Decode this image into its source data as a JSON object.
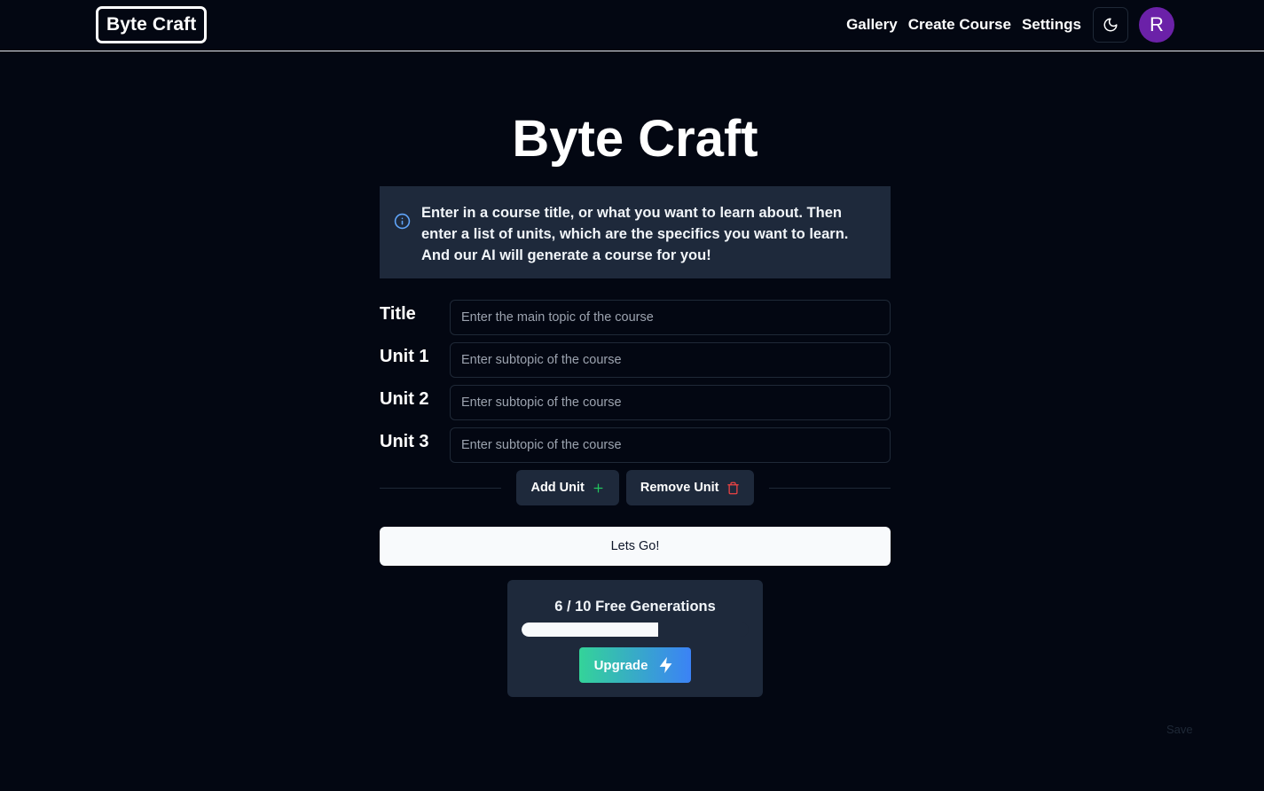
{
  "nav": {
    "logo": "Byte Craft",
    "links": [
      "Gallery",
      "Create Course",
      "Settings"
    ],
    "avatar_initial": "R",
    "theme_icon": "moon-icon"
  },
  "hero": {
    "title": "Byte Craft"
  },
  "info": {
    "icon": "info-icon",
    "text": "Enter in a course title, or what you want to learn about. Then enter a list of units, which are the specifics you want to learn. And our AI will generate a course for you!"
  },
  "form": {
    "rows": [
      {
        "label": "Title",
        "placeholder": "Enter the main topic of the course",
        "value": ""
      },
      {
        "label": "Unit 1",
        "placeholder": "Enter subtopic of the course",
        "value": ""
      },
      {
        "label": "Unit 2",
        "placeholder": "Enter subtopic of the course",
        "value": ""
      },
      {
        "label": "Unit 3",
        "placeholder": "Enter subtopic of the course",
        "value": ""
      }
    ],
    "add_unit_label": "Add Unit",
    "remove_unit_label": "Remove Unit",
    "submit_label": "Lets Go!"
  },
  "quota": {
    "text": "6 / 10 Free Generations",
    "used": 6,
    "limit": 10,
    "upgrade_label": "Upgrade"
  },
  "footer": {
    "save_label": "Save"
  },
  "colors": {
    "background": "#030712",
    "panel": "#1e293b",
    "avatar": "#6b21a8",
    "add_icon": "#22c55e",
    "remove_icon": "#ef4444",
    "info_icon": "#60a5fa"
  }
}
